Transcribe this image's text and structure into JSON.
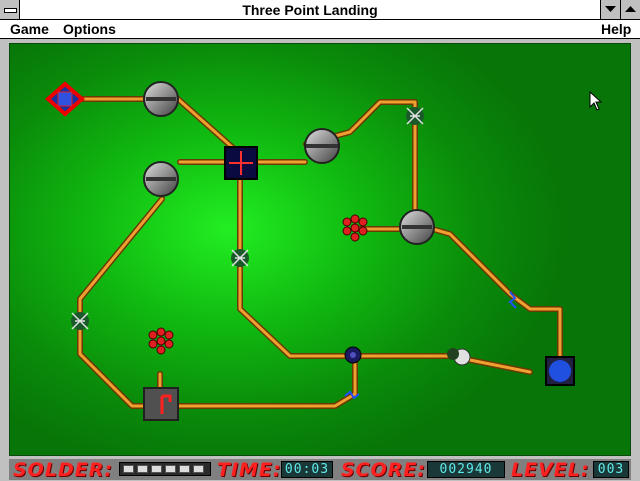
{
  "window": {
    "title": "Three Point Landing"
  },
  "menu": {
    "game": "Game",
    "options": "Options",
    "help": "Help"
  },
  "status": {
    "solder_label": "SOLDER:",
    "time_label": "TIME:",
    "time_value": "00:03",
    "score_label": "SCORE:",
    "score_value": "002940",
    "level_label": "LEVEL:",
    "level_value": "003",
    "solder_cells": 6
  },
  "icons": {
    "system": "system-menu-icon",
    "minimize": "minimize-icon",
    "maximize": "maximize-icon",
    "cursor": "arrow-cursor-icon"
  },
  "colors": {
    "board": "#10b810",
    "wire": "#e08a20",
    "label": "#ff2020"
  }
}
